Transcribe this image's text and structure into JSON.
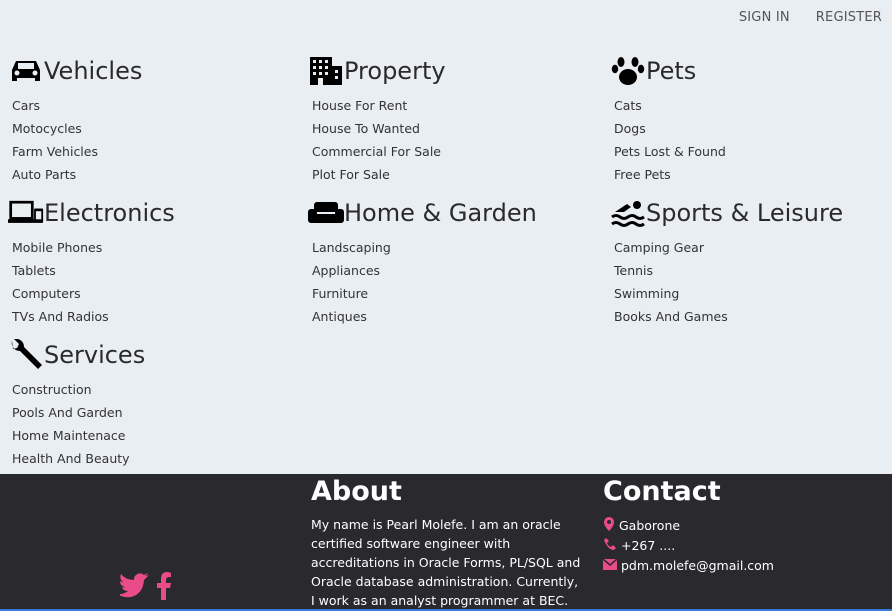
{
  "nav": {
    "sign_in": "SIGN IN",
    "register": "REGISTER"
  },
  "categories": [
    {
      "title": "Vehicles",
      "icon": "car-icon",
      "items": [
        "Cars",
        "Motocycles",
        "Farm Vehicles",
        "Auto Parts"
      ]
    },
    {
      "title": "Property",
      "icon": "building-icon",
      "items": [
        "House For Rent",
        "House To Wanted",
        "Commercial For Sale",
        "Plot For Sale"
      ]
    },
    {
      "title": "Pets",
      "icon": "paw-icon",
      "items": [
        "Cats",
        "Dogs",
        "Pets Lost & Found",
        "Free Pets"
      ]
    },
    {
      "title": "Electronics",
      "icon": "devices-icon",
      "items": [
        "Mobile Phones",
        "Tablets",
        "Computers",
        "TVs And Radios"
      ]
    },
    {
      "title": "Home & Garden",
      "icon": "couch-icon",
      "items": [
        "Landscaping",
        "Appliances",
        "Furniture",
        "Antiques"
      ]
    },
    {
      "title": "Sports & Leisure",
      "icon": "swimmer-icon",
      "items": [
        "Camping Gear",
        "Tennis",
        "Swimming",
        "Books And Games"
      ]
    },
    {
      "title": "Services",
      "icon": "wrench-icon",
      "items": [
        "Construction",
        "Pools And Garden",
        "Home Maintenace",
        "Health And Beauty"
      ]
    }
  ],
  "footer": {
    "about_title": "About",
    "about_text": "My name is Pearl Molefe. I am an oracle certified software engineer with accreditations in Oracle Forms, PL/SQL and Oracle database administration. Currently, I work as an analyst programmer at BEC. Check",
    "contact_title": "Contact",
    "location": "Gaborone",
    "phone": "+267 ....",
    "email": "pdm.molefe@gmail.com",
    "accent_color": "#ea4c89"
  }
}
